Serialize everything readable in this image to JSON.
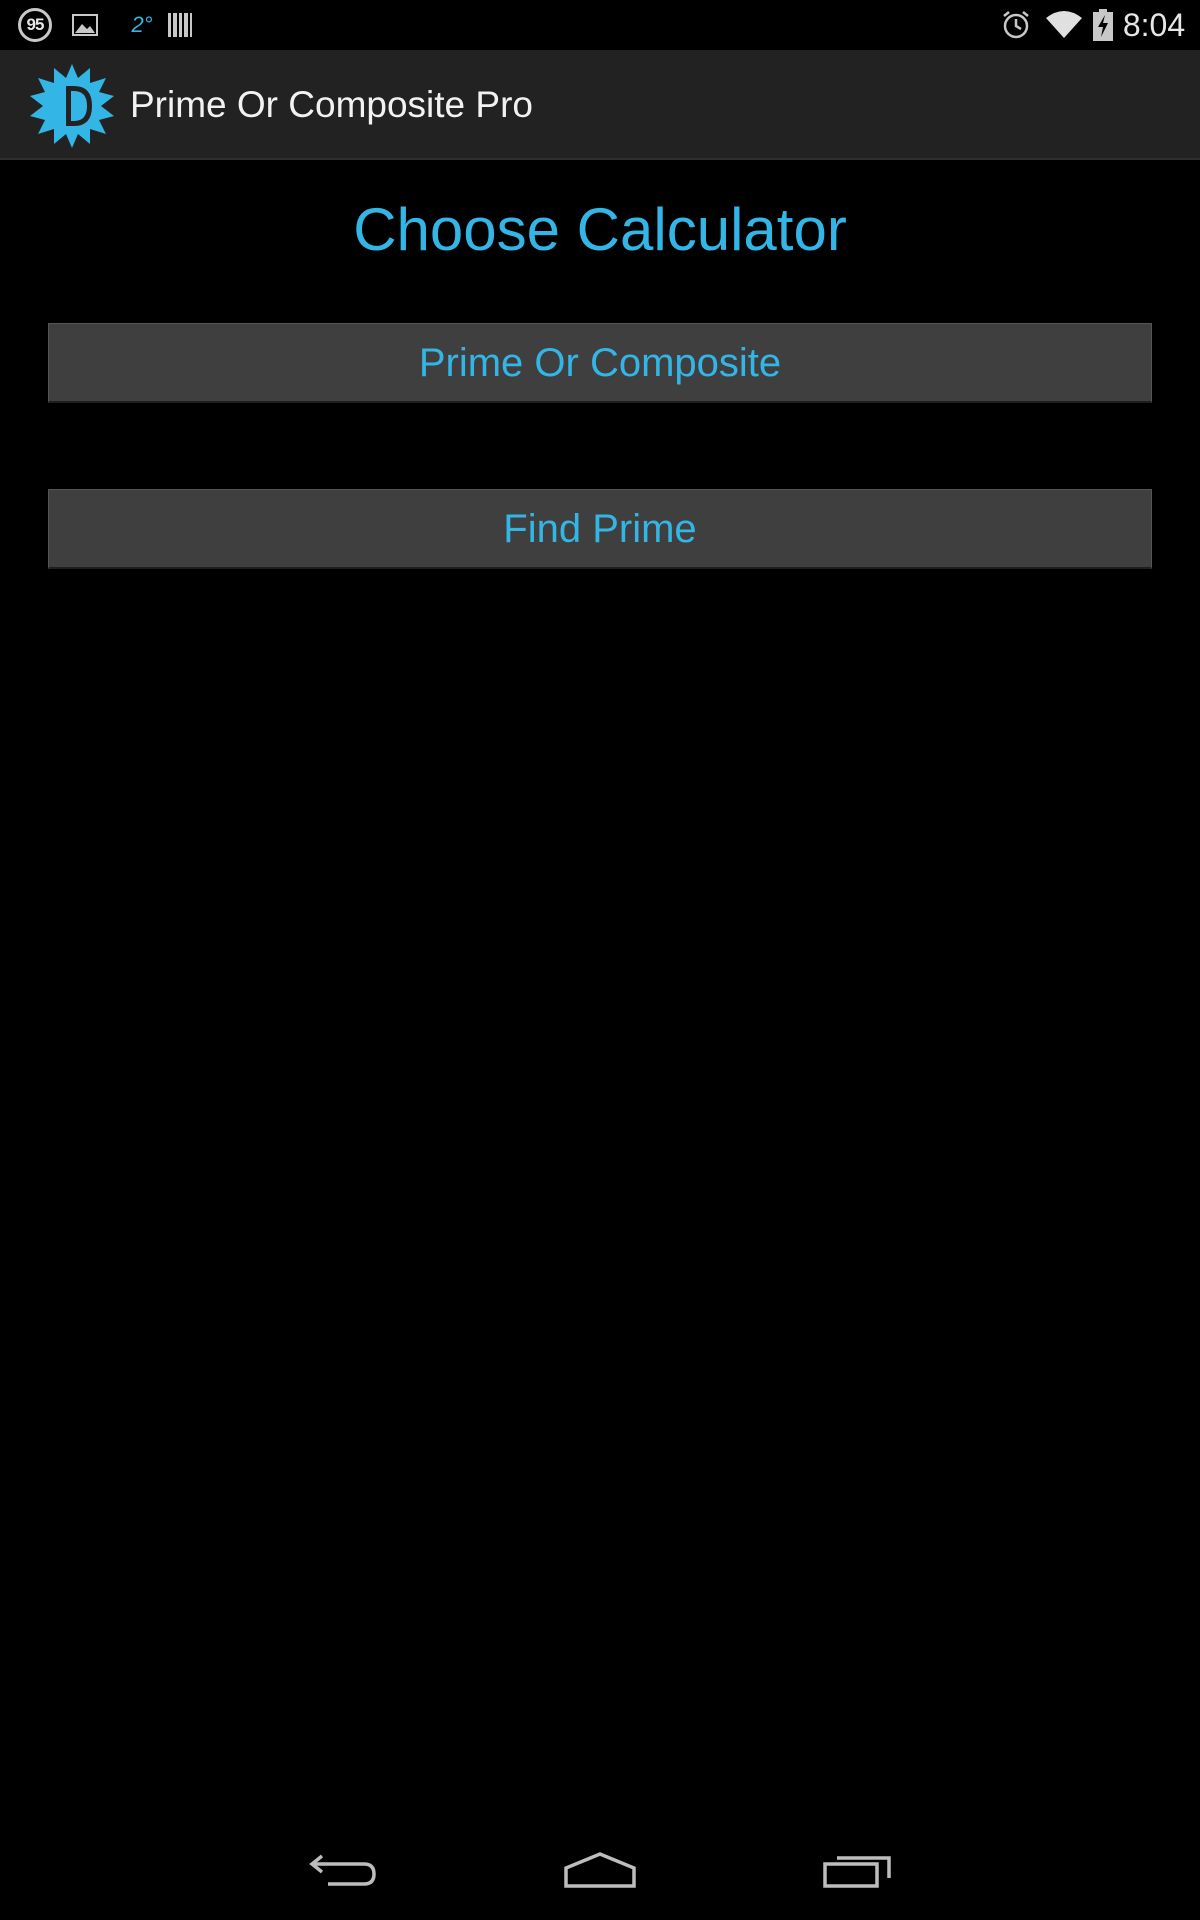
{
  "status_bar": {
    "notification_count": "95",
    "temperature": "2°",
    "time": "8:04",
    "icons": [
      "badge-count-icon",
      "image-icon",
      "temperature-icon",
      "barcode-icon",
      "alarm-icon",
      "wifi-icon",
      "battery-charging-icon"
    ]
  },
  "action_bar": {
    "title": "Prime Or Composite Pro",
    "icon": "app-logo-icon"
  },
  "main": {
    "heading": "Choose Calculator",
    "buttons": [
      {
        "label": "Prime Or Composite"
      },
      {
        "label": "Find Prime"
      }
    ]
  },
  "nav_bar": {
    "icons": [
      "back-icon",
      "home-icon",
      "recents-icon"
    ]
  },
  "colors": {
    "accent": "#33b5e5",
    "action_bar_bg": "#222222",
    "button_bg": "#3f3f3f",
    "background": "#000000"
  }
}
